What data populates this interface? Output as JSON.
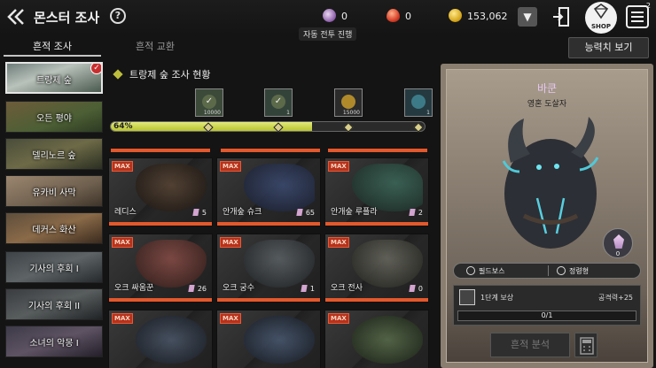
{
  "header": {
    "title": "몬스터 조사",
    "help": "?",
    "auto_battle": "자동 전투 진행",
    "currencies": [
      {
        "icon": "purple-gem-icon",
        "value": "0"
      },
      {
        "icon": "red-ruby-icon",
        "value": "0"
      },
      {
        "icon": "gold-coin-icon",
        "value": "153,062"
      }
    ],
    "shop_label": "SHOP",
    "menu_badge": "2"
  },
  "tabs": [
    {
      "label": "흔적 조사",
      "active": true
    },
    {
      "label": "흔적 교환",
      "active": false
    }
  ],
  "stats_button": "능력치 보기",
  "regions": [
    {
      "label": "트랑제 숲",
      "selected": true
    },
    {
      "label": "오든 평야",
      "selected": false
    },
    {
      "label": "델리노르 숲",
      "selected": false
    },
    {
      "label": "유카비 사막",
      "selected": false
    },
    {
      "label": "데커스 화산",
      "selected": false
    },
    {
      "label": "기사의 후회 I",
      "selected": false
    },
    {
      "label": "기사의 후회 II",
      "selected": false
    },
    {
      "label": "소녀의 악몽 I",
      "selected": false
    }
  ],
  "survey": {
    "title": "트랑제 숲 조사 현황",
    "progress_label": "64%",
    "progress": 0.64,
    "rewards": [
      {
        "icon": "claimed-reward-icon",
        "count": "10000"
      },
      {
        "icon": "claimed-reward-icon",
        "count": "1"
      },
      {
        "icon": "gold-coin-icon",
        "count": "15000"
      },
      {
        "icon": "crystal-reward-icon",
        "count": "1"
      }
    ]
  },
  "monsters": [
    {
      "name": "레디스",
      "count": "5",
      "badge": "MAX"
    },
    {
      "name": "안개숲 슈크",
      "count": "65",
      "badge": "MAX"
    },
    {
      "name": "안개숲 루플라",
      "count": "2",
      "badge": "MAX"
    },
    {
      "name": "오크 싸움꾼",
      "count": "26",
      "badge": "MAX"
    },
    {
      "name": "오크 궁수",
      "count": "1",
      "badge": "MAX"
    },
    {
      "name": "오크 전사",
      "count": "0",
      "badge": "MAX"
    },
    {
      "name": "",
      "count": "",
      "badge": "MAX"
    },
    {
      "name": "",
      "count": "",
      "badge": "MAX"
    },
    {
      "name": "",
      "count": "",
      "badge": "MAX"
    }
  ],
  "detail": {
    "name": "바쿤",
    "title": "영혼 도살자",
    "crystal_count": "0",
    "type1": "필드보스",
    "type2": "정령형",
    "reward_label": "1단계 보상",
    "reward_stat": "공격력+25",
    "reward_progress": "0/1",
    "analyze_button": "흔적 분석"
  },
  "colors": {
    "accent_orange": "#e4582c",
    "progress_yellow": "#c8d23f",
    "max_red": "#b8321b",
    "monster_name_purple": "#e4c6ef"
  }
}
